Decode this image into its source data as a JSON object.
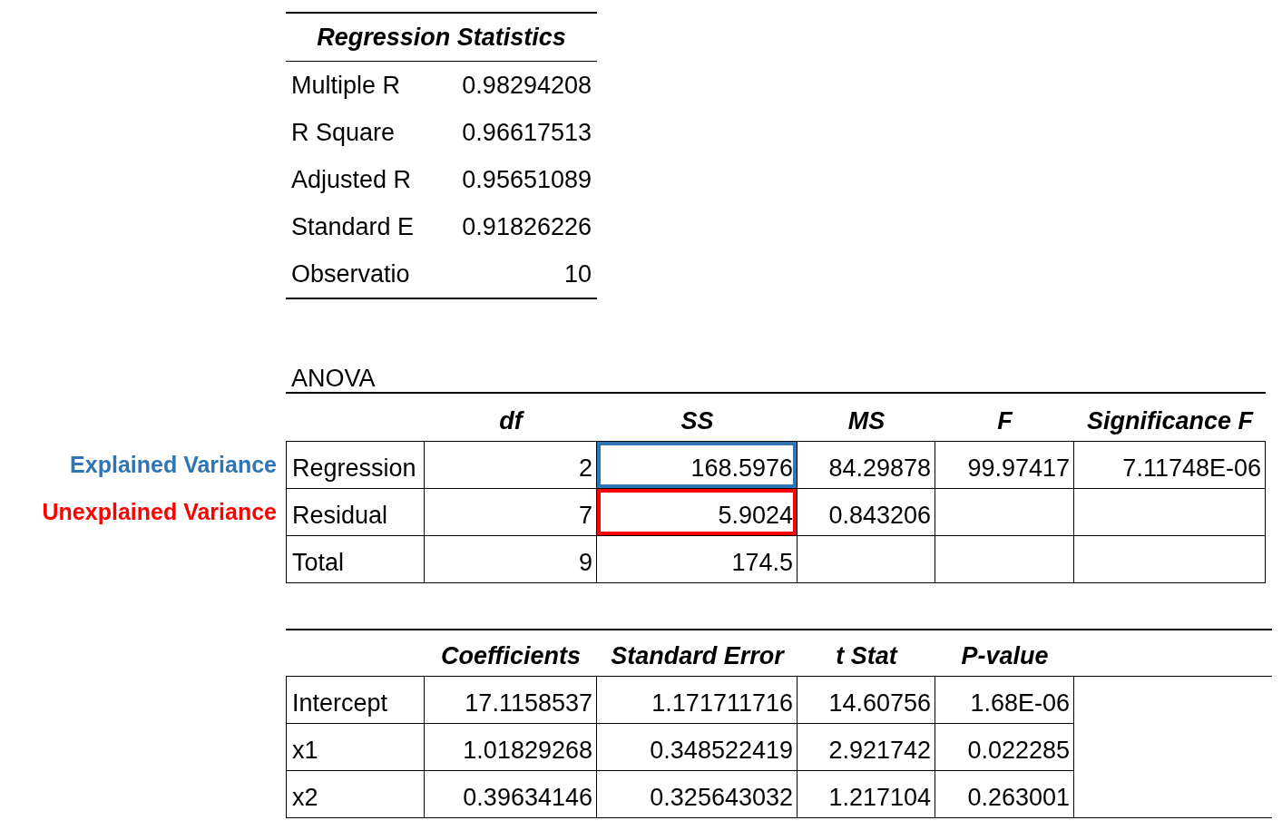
{
  "regression_statistics": {
    "title": "Regression Statistics",
    "rows": [
      {
        "label": "Multiple R",
        "value": "0.98294208"
      },
      {
        "label": "R Square",
        "value": "0.96617513"
      },
      {
        "label": "Adjusted R",
        "value": "0.95651089"
      },
      {
        "label": "Standard E",
        "value": "0.91826226"
      },
      {
        "label": "Observatio",
        "value": "10"
      }
    ]
  },
  "anova": {
    "title": "ANOVA",
    "columns": [
      "df",
      "SS",
      "MS",
      "F",
      "Significance F"
    ],
    "rows": [
      {
        "label": "Regression",
        "cells": [
          "2",
          "168.5976",
          "84.29878",
          "99.97417",
          "7.11748E-06"
        ],
        "annotation": {
          "text": "Explained Variance",
          "color": "#2e75b6"
        }
      },
      {
        "label": "Residual",
        "cells": [
          "7",
          "5.9024",
          "0.843206"
        ],
        "annotation": {
          "text": "Unexplained Variance",
          "color": "#ff0000"
        }
      },
      {
        "label": "Total",
        "cells": [
          "9",
          "174.5"
        ]
      }
    ]
  },
  "coefficients": {
    "columns": [
      "Coefficients",
      "Standard Error",
      "t Stat",
      "P-value"
    ],
    "rows": [
      {
        "label": "Intercept",
        "cells": [
          "17.1158537",
          "1.171711716",
          "14.60756",
          "1.68E-06"
        ]
      },
      {
        "label": "x1",
        "cells": [
          "1.01829268",
          "0.348522419",
          "2.921742",
          "0.022285"
        ]
      },
      {
        "label": "x2",
        "cells": [
          "0.39634146",
          "0.325643032",
          "1.217104",
          "0.263001"
        ]
      }
    ]
  }
}
